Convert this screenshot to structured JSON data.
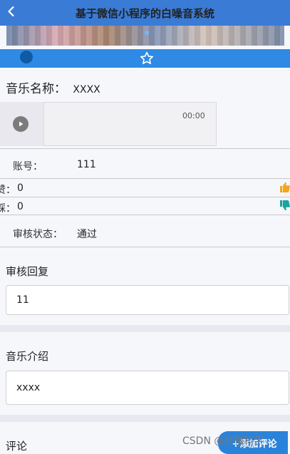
{
  "app": {
    "title": "基于微信小程序的白噪音系统"
  },
  "icons": {
    "back": "chevron-left-icon",
    "star": "star-icon",
    "play": "play-icon",
    "thumb_up": "thumb-up-icon",
    "thumb_down": "thumb-down-icon"
  },
  "music": {
    "name_label": "音乐名称：",
    "name_value": "XXXX",
    "time": "00:00"
  },
  "details": {
    "account_label": "账号：",
    "account_value": "111",
    "likes_label": "赞：",
    "likes_value": "0",
    "dislikes_label": "踩：",
    "dislikes_value": "0",
    "status_label": "审核状态：",
    "status_value": "通过"
  },
  "review_reply": {
    "label": "审核回复",
    "value": "11"
  },
  "music_intro": {
    "label": "音乐介绍",
    "value": "xxxx"
  },
  "comments": {
    "label": "评论",
    "add_button": "+添加评论"
  },
  "watermark": {
    "text": "CSDN @升幅科学"
  },
  "colors": {
    "brand_blue": "#3a7bd5",
    "secondary_blue": "#2f8ae5",
    "thumb_up": "#f3a51e",
    "thumb_down": "#1aa39f"
  }
}
